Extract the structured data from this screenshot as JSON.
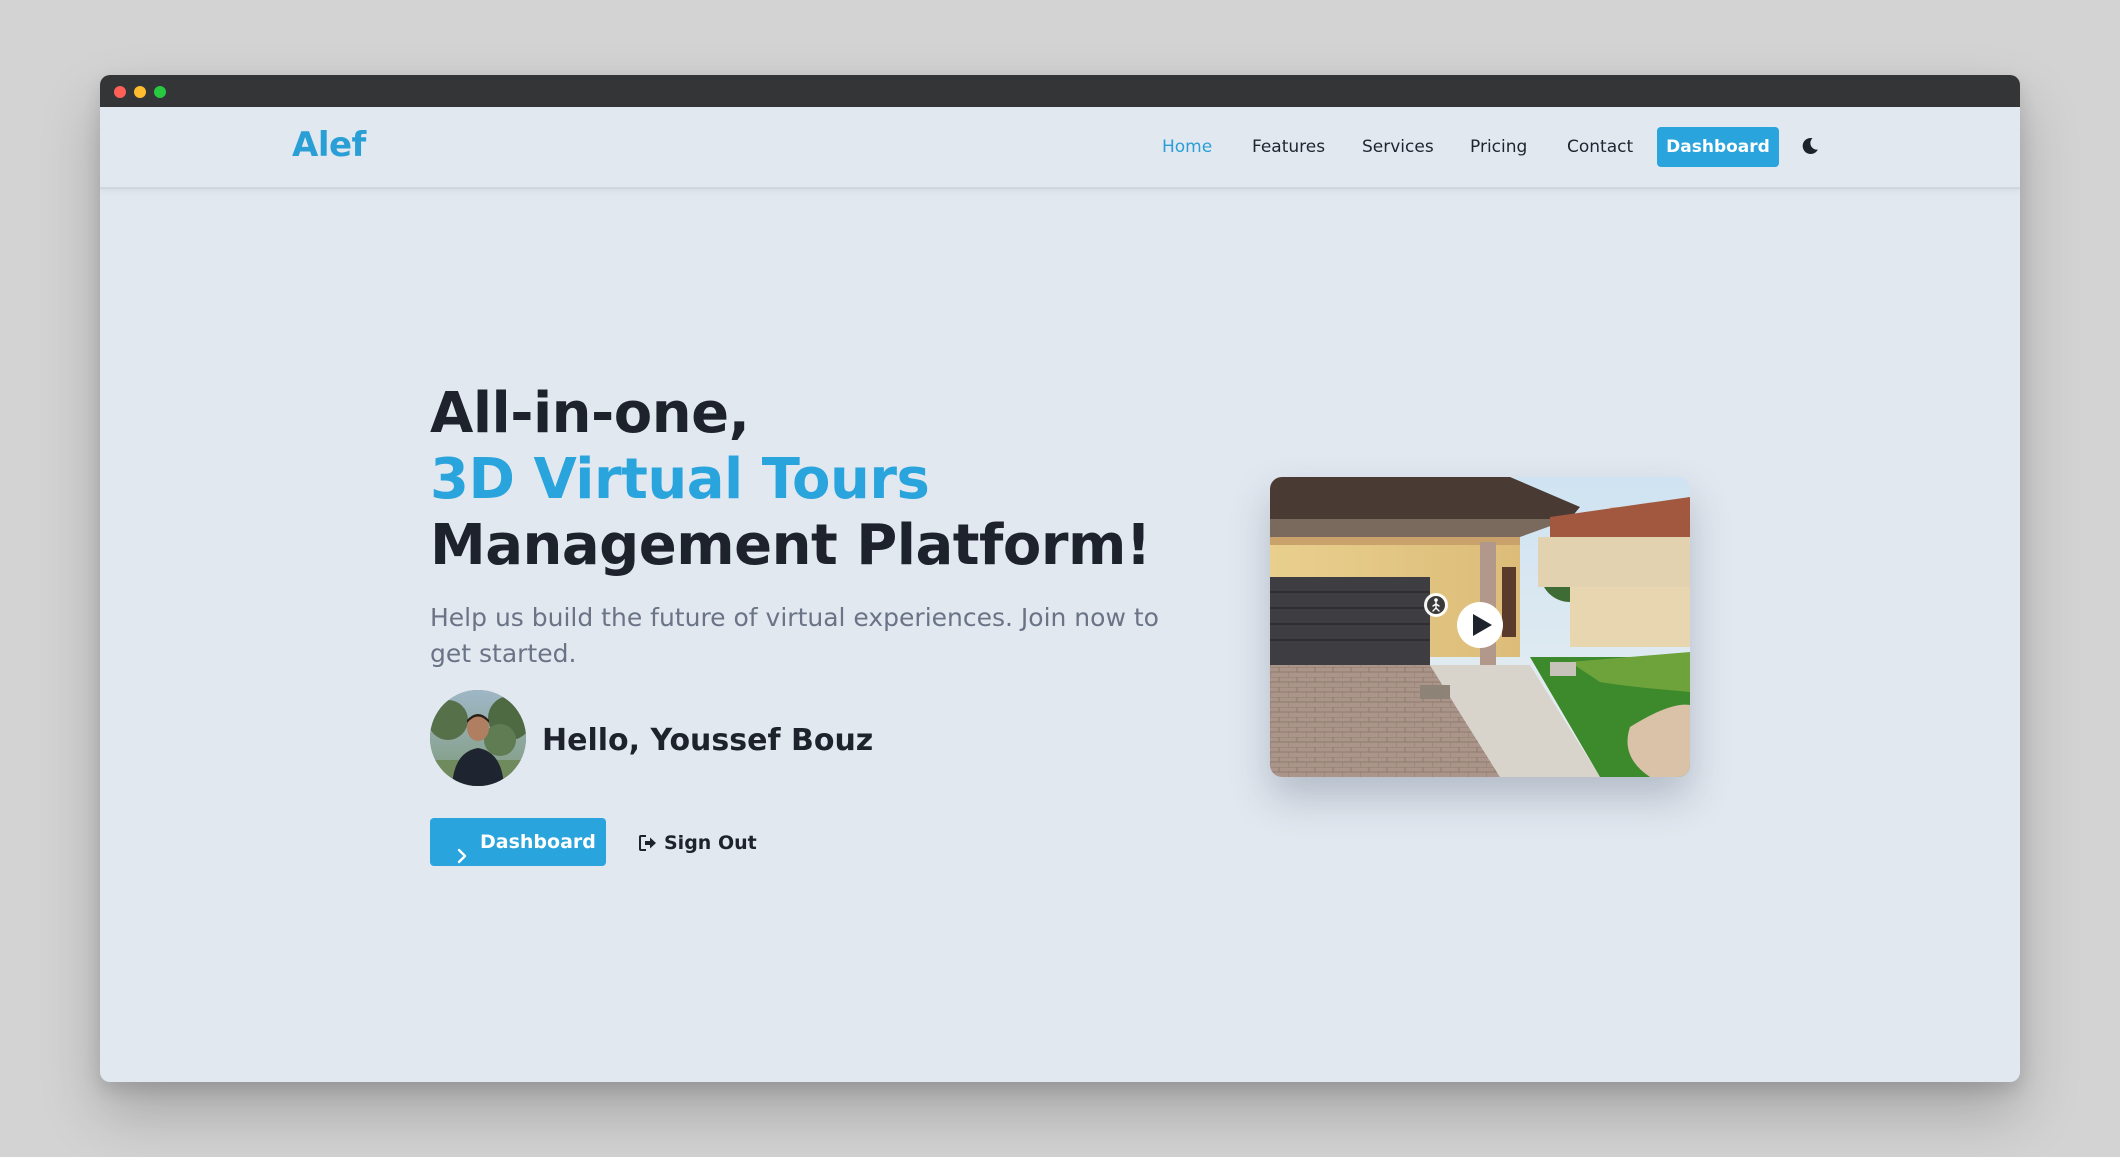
{
  "brand": {
    "logo": "Alef",
    "accent_color": "#2aa4dc"
  },
  "window": {
    "controls": [
      "close",
      "minimize",
      "maximize"
    ]
  },
  "nav": {
    "items": [
      {
        "label": "Home",
        "active": true
      },
      {
        "label": "Features",
        "active": false
      },
      {
        "label": "Services",
        "active": false
      },
      {
        "label": "Pricing",
        "active": false
      },
      {
        "label": "Contact",
        "active": false
      }
    ],
    "dashboard_button": "Dashboard",
    "theme_toggle_icon": "moon-icon"
  },
  "hero": {
    "title_line1": "All-in-one,",
    "title_line2": "3D Virtual Tours",
    "title_line3": "Management Platform!",
    "subtitle": "Help us build the future of virtual experiences. Join now to get started.",
    "greeting": "Hello, Youssef Bouz",
    "dashboard_button": "Dashboard",
    "signout_button": "Sign Out",
    "dashboard_button_icon": "chevron-right-icon",
    "signout_button_icon": "sign-out-icon"
  },
  "tour_preview": {
    "play_icon": "play-icon",
    "walker_icon": "walking-person-icon"
  }
}
